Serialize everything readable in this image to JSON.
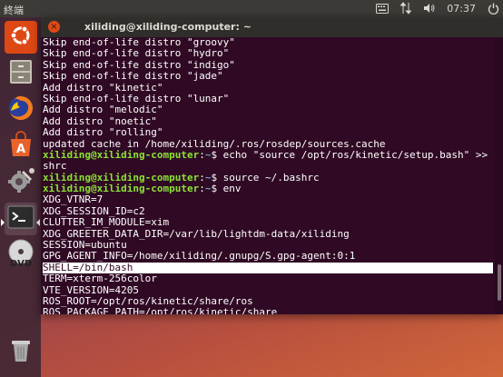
{
  "topbar": {
    "app_name": "終端",
    "clock": "07:37",
    "icons": [
      "keyboard-icon",
      "network-icon",
      "volume-icon",
      "power-icon"
    ]
  },
  "launcher": {
    "items": [
      {
        "name": "ubuntu-dash",
        "icon": "ubuntu-logo-icon"
      },
      {
        "name": "files",
        "icon": "file-cabinet-icon"
      },
      {
        "name": "firefox",
        "icon": "firefox-icon"
      },
      {
        "name": "software-center",
        "icon": "shopping-bag-icon"
      },
      {
        "name": "system-settings",
        "icon": "gear-wrench-icon"
      },
      {
        "name": "terminal",
        "icon": "terminal-icon"
      },
      {
        "name": "dvd",
        "icon": "dvd-icon",
        "label": "DVD"
      },
      {
        "name": "trash",
        "icon": "trash-icon"
      }
    ],
    "software_label": "A",
    "dvd_label": "DVD"
  },
  "window": {
    "title": "xiliding@xiliding-computer: ~",
    "close_glyph": "×"
  },
  "terminal": {
    "lines": [
      "Skip end-of-life distro \"groovy\"",
      "Skip end-of-life distro \"hydro\"",
      "Skip end-of-life distro \"indigo\"",
      "Skip end-of-life distro \"jade\"",
      "Add distro \"kinetic\"",
      "Skip end-of-life distro \"lunar\"",
      "Add distro \"melodic\"",
      "Add distro \"noetic\"",
      "Add distro \"rolling\"",
      "updated cache in /home/xiliding/.ros/rosdep/sources.cache"
    ],
    "cmd1": {
      "user": "xiliding@xiliding-computer",
      "path": "~",
      "command": "$ echo \"source /opt/ros/kinetic/setup.bash\" >> ~/.ba",
      "wrap": "shrc"
    },
    "cmd2": {
      "user": "xiliding@xiliding-computer",
      "path": "~",
      "command": "$ source ~/.bashrc"
    },
    "cmd3": {
      "user": "xiliding@xiliding-computer",
      "path": "~",
      "command": "$ env"
    },
    "env_lines": [
      "XDG_VTNR=7",
      "XDG_SESSION_ID=c2",
      "CLUTTER_IM_MODULE=xim",
      "XDG_GREETER_DATA_DIR=/var/lib/lightdm-data/xiliding",
      "SESSION=ubuntu",
      "GPG_AGENT_INFO=/home/xiliding/.gnupg/S.gpg-agent:0:1",
      "SHELL=/bin/bash",
      "TERM=xterm-256color",
      "VTE_VERSION=4205",
      "ROS_ROOT=/opt/ros/kinetic/share/ros",
      "ROS_PACKAGE_PATH=/opt/ros/kinetic/share"
    ],
    "highlighted_line_index": 6
  },
  "colors": {
    "terminal_bg": "#300a24",
    "prompt_green": "#8ae234",
    "path_blue": "#729fcf",
    "close_orange": "#df4a16",
    "panel": "#3c3b37"
  }
}
